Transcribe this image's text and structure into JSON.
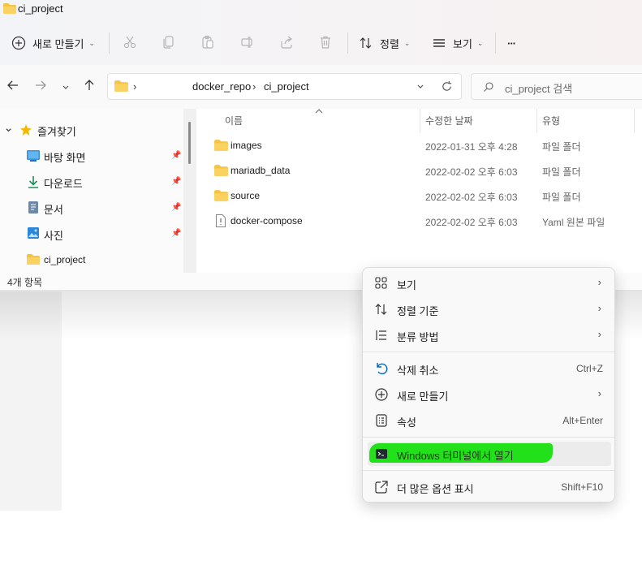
{
  "window": {
    "title": "ci_project"
  },
  "toolbar": {
    "new_label": "새로 만들기",
    "sort_label": "정렬",
    "view_label": "보기",
    "more_label": "···"
  },
  "address": {
    "path": [
      "docker_repo",
      "ci_project"
    ],
    "separator": "›",
    "search_placeholder": "ci_project 검색"
  },
  "nav_pane": {
    "quick_access": "즐겨찾기",
    "items": [
      {
        "label": "바탕 화면",
        "icon": "desktop-icon",
        "pinned": true
      },
      {
        "label": "다운로드",
        "icon": "download-icon",
        "pinned": true
      },
      {
        "label": "문서",
        "icon": "document-icon",
        "pinned": true
      },
      {
        "label": "사진",
        "icon": "picture-icon",
        "pinned": true
      },
      {
        "label": "ci_project",
        "icon": "folder-icon",
        "pinned": false
      }
    ]
  },
  "file_list": {
    "columns": [
      "이름",
      "수정한 날짜",
      "유형"
    ],
    "rows": [
      {
        "name": "images",
        "date": "2022-01-31 오후 4:28",
        "type": "파일 폴더",
        "icon": "folder-icon"
      },
      {
        "name": "mariadb_data",
        "date": "2022-02-02 오후 6:03",
        "type": "파일 폴더",
        "icon": "folder-icon"
      },
      {
        "name": "source",
        "date": "2022-02-02 오후 6:03",
        "type": "파일 폴더",
        "icon": "folder-icon"
      },
      {
        "name": "docker-compose",
        "date": "2022-02-02 오후 6:03",
        "type": "Yaml 원본 파일",
        "icon": "file-icon"
      }
    ]
  },
  "status": {
    "item_count": "4개 항목"
  },
  "context_menu": {
    "view": "보기",
    "sort_by": "정렬 기준",
    "group_by": "분류 방법",
    "undo_delete": "삭제 취소",
    "undo_shortcut": "Ctrl+Z",
    "new": "새로 만들기",
    "properties": "속성",
    "properties_shortcut": "Alt+Enter",
    "open_terminal": "Windows 터미널에서 열기",
    "more_options": "더 많은 옵션 표시",
    "more_options_shortcut": "Shift+F10"
  },
  "colors": {
    "folder": "#f6c444",
    "accent": "#0067c0",
    "highlight": "#22e01a",
    "star": "#f5b800"
  }
}
